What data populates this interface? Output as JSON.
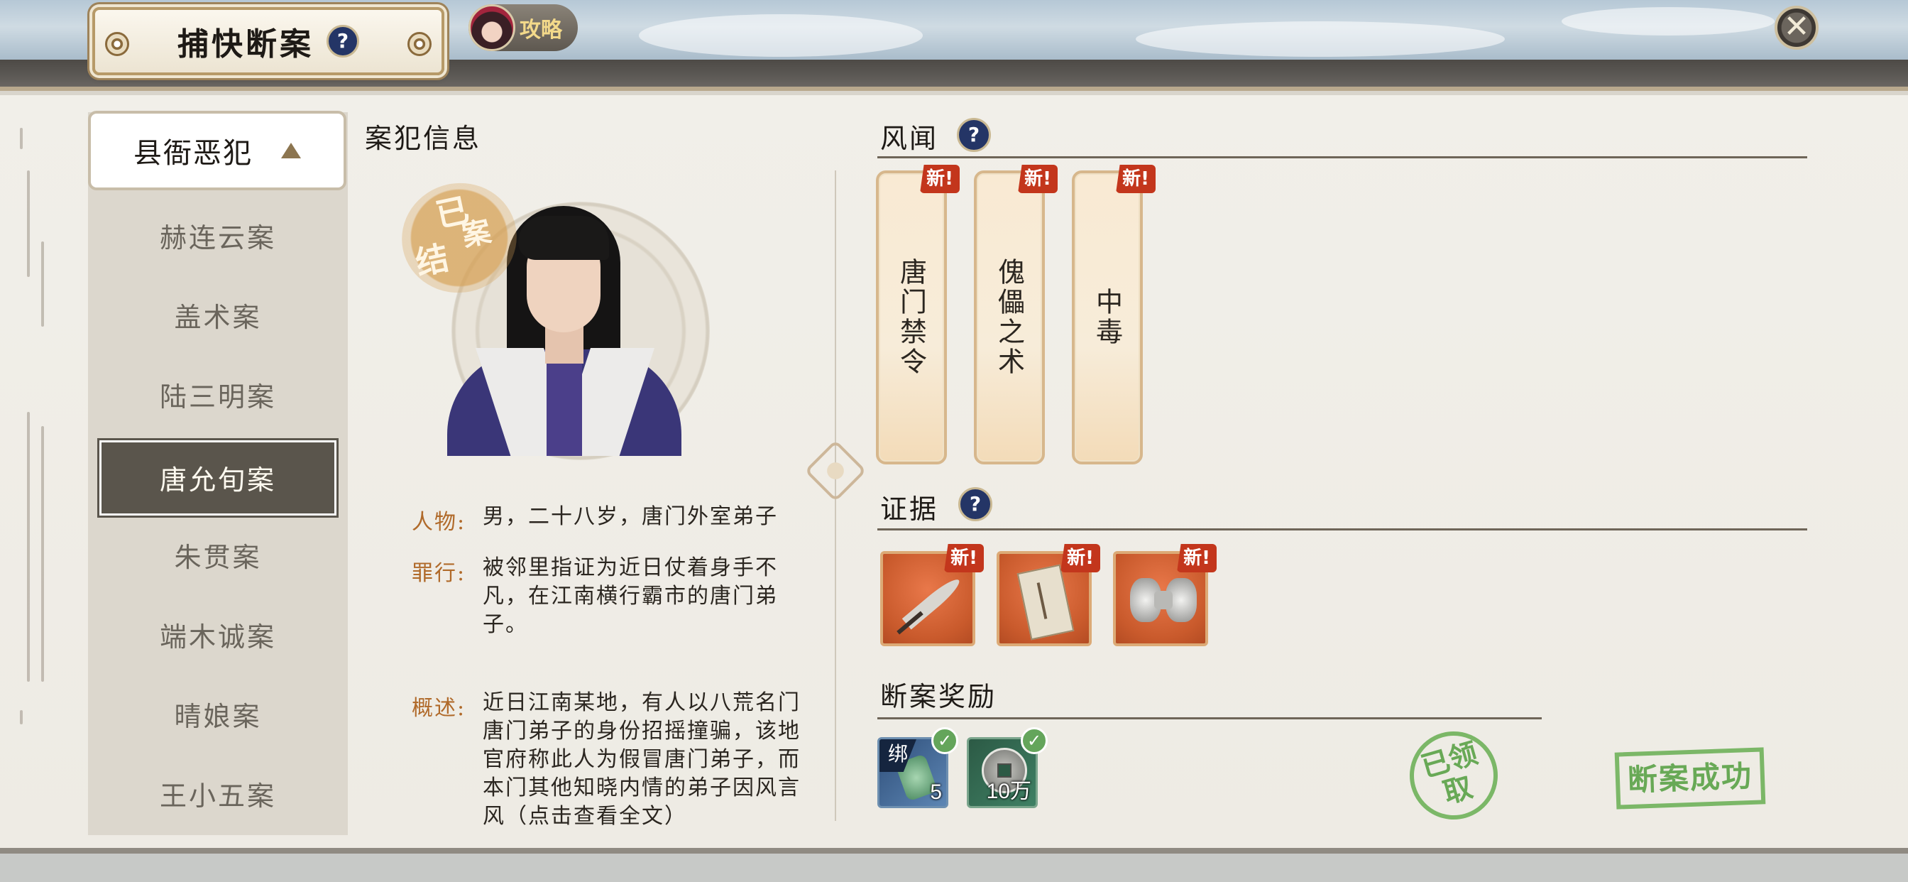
{
  "header": {
    "title": "捕快断案",
    "help_icon": "?",
    "guide_label": "攻略",
    "close_icon": "✕"
  },
  "sidebar": {
    "category": "县衙恶犯",
    "items": [
      {
        "label": "赫连云案",
        "active": false
      },
      {
        "label": "盖术案",
        "active": false
      },
      {
        "label": "陆三明案",
        "active": false
      },
      {
        "label": "唐允旬案",
        "active": true
      },
      {
        "label": "朱贯案",
        "active": false
      },
      {
        "label": "端木诚案",
        "active": false
      },
      {
        "label": "晴娘案",
        "active": false
      },
      {
        "label": "王小五案",
        "active": false
      }
    ]
  },
  "case_info": {
    "title": "案犯信息",
    "stamp_status": [
      "已",
      "结",
      "案"
    ],
    "person_key": "人物:",
    "person_val": "男，二十八岁，唐门外室弟子",
    "crime_key": "罪行:",
    "crime_val": "被邻里指证为近日仗着身手不凡，在江南横行霸市的唐门弟子。",
    "summary_key": "概述:",
    "summary_val": "近日江南某地，有人以八荒名门唐门弟子的身份招摇撞骗，该地官府称此人为假冒唐门弟子，而本门其他知晓内情的弟子因风言风（点击查看全文）"
  },
  "rumors": {
    "title": "风闻",
    "help_icon": "?",
    "badge": "新!",
    "cards": [
      "唐门禁令",
      "傀儡之术",
      "中毒"
    ]
  },
  "evidence": {
    "title": "证据",
    "help_icon": "?",
    "badge": "新!",
    "items": [
      "feather-quill-icon",
      "document-letter-icon",
      "silver-ingot-icon"
    ]
  },
  "rewards": {
    "title": "断案奖励",
    "items": [
      {
        "icon": "jade-token-icon",
        "count": "5",
        "bind_tag": "绑"
      },
      {
        "icon": "copper-coin-icon",
        "count": "10万"
      }
    ],
    "check_icon": "✓",
    "stamp_claimed": "已领取",
    "stamp_success": "断案成功"
  },
  "colors": {
    "accent_orange": "#b06a2a",
    "badge_red": "#c3361c",
    "stamp_green": "#5aa247",
    "help_blue": "#243566"
  }
}
